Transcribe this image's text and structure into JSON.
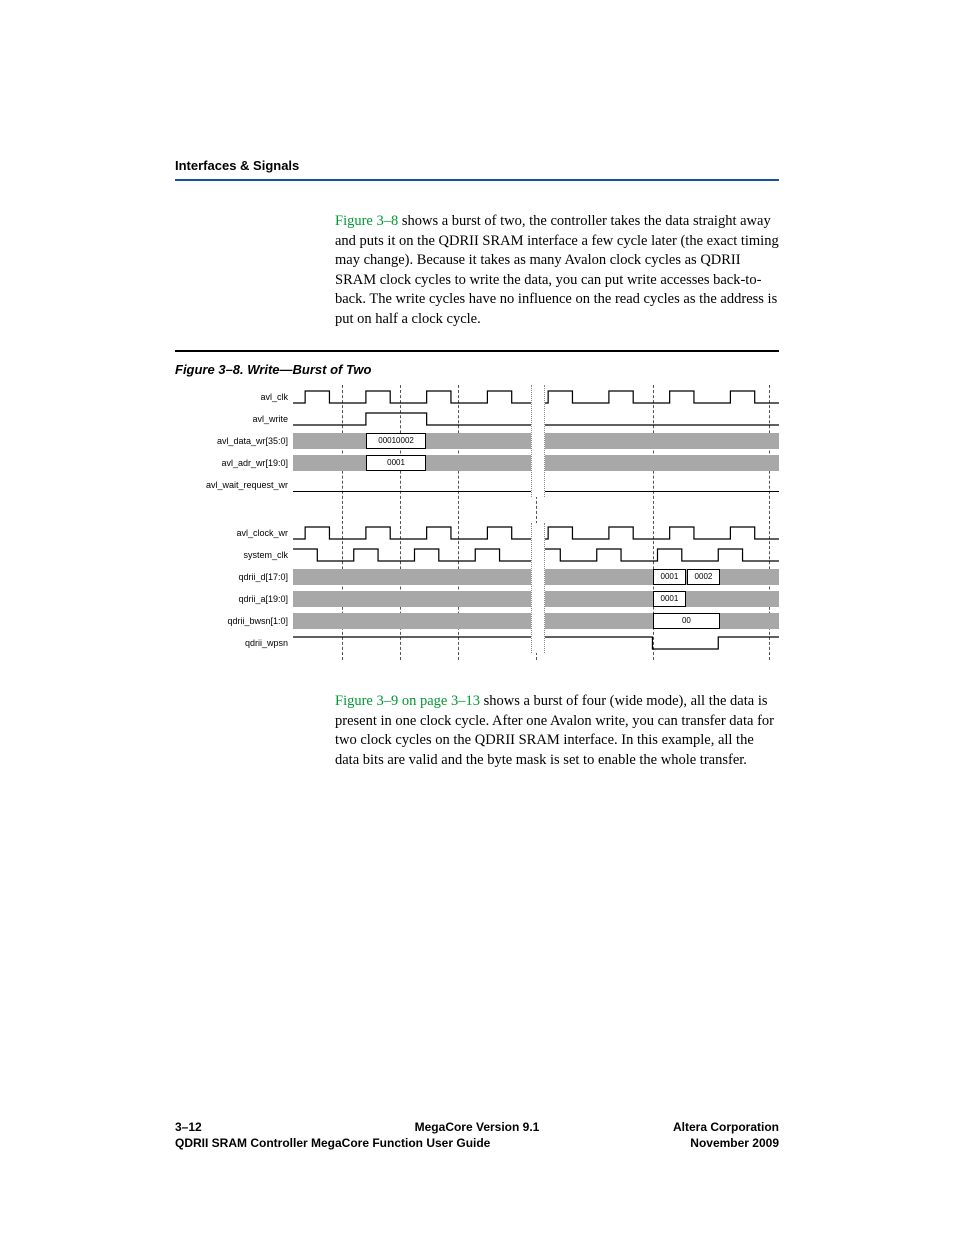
{
  "header": {
    "section": "Interfaces & Signals"
  },
  "para1": {
    "ref": "Figure 3–8",
    "text": " shows a burst of two, the controller takes the data straight away and puts it on the QDRII SRAM interface a few cycle later (the exact timing may change). Because it takes as many Avalon clock cycles as QDRII SRAM clock cycles to write the data, you can put write accesses back-to-back. The write cycles have no influence on the read cycles as the address is put on half a clock cycle."
  },
  "figure": {
    "caption": "Figure 3–8. Write—Burst of Two",
    "signals": {
      "avl_clk": "avl_clk",
      "avl_write": "avl_write",
      "avl_data_wr": "avl_data_wr[35:0]",
      "avl_adr_wr": "avl_adr_wr[19:0]",
      "avl_wait_request_wr": "avl_wait_request_wr",
      "avl_clock_wr": "avl_clock_wr",
      "system_clk": "system_clk",
      "qdrii_d": "qdrii_d[17:0]",
      "qdrii_a": "qdrii_a[19:0]",
      "qdrii_bwsn": "qdrii_bwsn[1:0]",
      "qdrii_wpsn": "qdrii_wpsn"
    },
    "values": {
      "data_wr": "00010002",
      "adr_wr": "0001",
      "qd_a": "0001",
      "qd_b": "0002",
      "qa": "0001",
      "bwsn": "00"
    }
  },
  "para2": {
    "ref": "Figure 3–9 on page 3–13",
    "text": " shows a burst of four (wide mode), all the data is present in one clock cycle. After one Avalon write, you can transfer data for two clock cycles on the QDRII SRAM interface. In this example, all the data bits are valid and the byte mask is set to enable the whole transfer."
  },
  "footer": {
    "page": "3–12",
    "center": "MegaCore Version 9.1",
    "right1": "Altera Corporation",
    "sub": "QDRII SRAM Controller MegaCore Function User Guide",
    "right2": "November 2009"
  },
  "chart_data": {
    "type": "table",
    "description": "Timing diagram: write burst of two on Avalon side then QDRII SRAM side",
    "signals": [
      {
        "name": "avl_clk",
        "kind": "clock"
      },
      {
        "name": "avl_write",
        "kind": "pulse",
        "high_during": "one avl_clk cycle near start"
      },
      {
        "name": "avl_data_wr[35:0]",
        "kind": "bus",
        "value_during_write": "00010002"
      },
      {
        "name": "avl_adr_wr[19:0]",
        "kind": "bus",
        "value_during_write": "0001"
      },
      {
        "name": "avl_wait_request_wr",
        "kind": "level",
        "value": "low"
      },
      {
        "name": "avl_clock_wr",
        "kind": "clock"
      },
      {
        "name": "system_clk",
        "kind": "clock"
      },
      {
        "name": "qdrii_d[17:0]",
        "kind": "bus",
        "values": [
          "0001",
          "0002"
        ],
        "timing": "two half-cycles later on QDRII side"
      },
      {
        "name": "qdrii_a[19:0]",
        "kind": "bus",
        "values": [
          "0001"
        ],
        "timing": "half clock cycle"
      },
      {
        "name": "qdrii_bwsn[1:0]",
        "kind": "bus",
        "values": [
          "00"
        ]
      },
      {
        "name": "qdrii_wpsn",
        "kind": "pulse",
        "low_during": "one system_clk cycle aligned with qdrii_d/a"
      }
    ]
  }
}
